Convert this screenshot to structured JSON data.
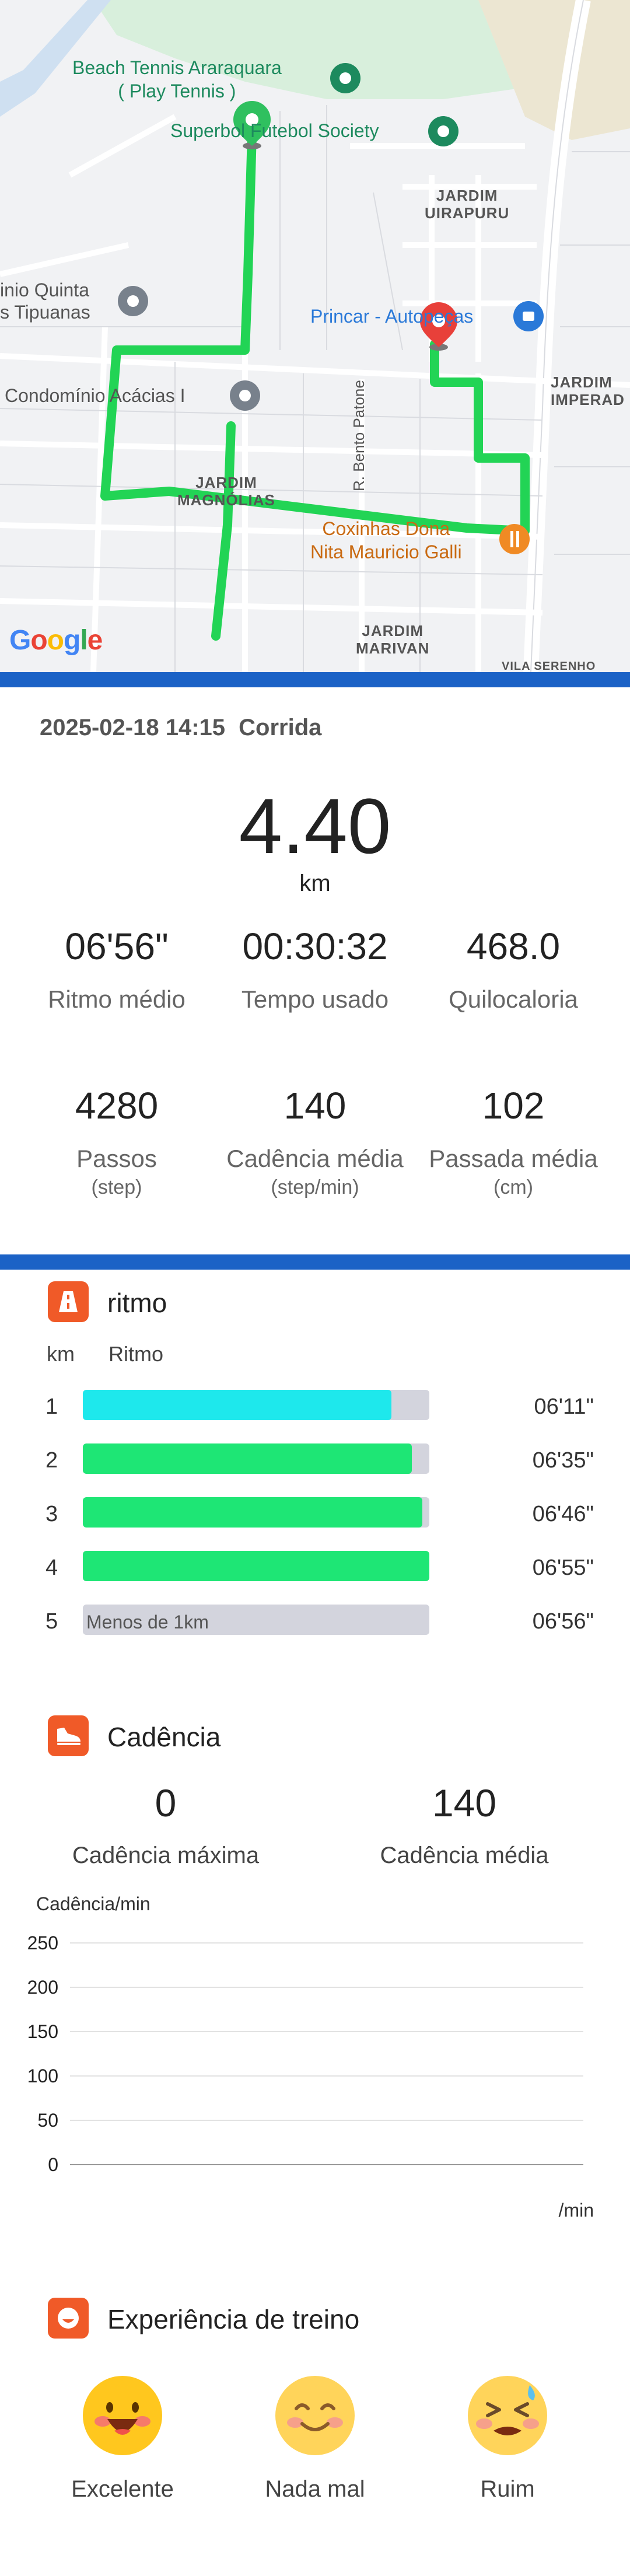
{
  "map": {
    "labels": {
      "beach_tennis": "Beach Tennis Araraquara\n( Play Tennis )",
      "superbol": "Superbol Futebol Society",
      "jardim_uirapuru": "JARDIM\nUIRAPURU",
      "quinta": "inio Quinta\ns Tipuanas",
      "princar": "Princar - Autopeças",
      "condominio": "Condomínio Acácias I",
      "jardim_imperador": "JARDIM\nIMPERAD",
      "jardim_magnolias": "JARDIM\nMAGNÓLIAS",
      "bento_patone": "R. Bento Patone",
      "coxinhas": "Coxinhas Dona\nNita Mauricio Galli",
      "jardim_marivan": "JARDIM\nMARIVAN",
      "vila_serenho": "VILA SERENHO"
    },
    "google": [
      "G",
      "o",
      "o",
      "g",
      "l",
      "e"
    ]
  },
  "summary": {
    "datetime": "2025-02-18 14:15",
    "activity": "Corrida",
    "distance": "4.40",
    "distance_unit": "km",
    "pace": "06'56\"",
    "pace_label": "Ritmo médio",
    "time": "00:30:32",
    "time_label": "Tempo usado",
    "calories": "468.0",
    "calories_label": "Quilocaloria",
    "steps": "4280",
    "steps_label": "Passos",
    "steps_unit": "(step)",
    "cadence": "140",
    "cadence_label": "Cadência média",
    "cadence_unit": "(step/min)",
    "stride": "102",
    "stride_label": "Passada média",
    "stride_unit": "(cm)"
  },
  "pace_section": {
    "title": "ritmo",
    "col_km": "km",
    "col_pace": "Ritmo",
    "rows": [
      {
        "km": "1",
        "time": "06'11\"",
        "fill": 0.89,
        "color": "#1ee8ec",
        "label": ""
      },
      {
        "km": "2",
        "time": "06'35\"",
        "fill": 0.95,
        "color": "#1ee675",
        "label": ""
      },
      {
        "km": "3",
        "time": "06'46\"",
        "fill": 0.98,
        "color": "#1ee675",
        "label": ""
      },
      {
        "km": "4",
        "time": "06'55\"",
        "fill": 1.0,
        "color": "#1ee675",
        "label": ""
      },
      {
        "km": "5",
        "time": "06'56\"",
        "fill": 0.0,
        "color": "#d3d4dd",
        "label": "Menos de 1km"
      }
    ]
  },
  "cadence_section": {
    "title": "Cadência",
    "max_value": "0",
    "max_label": "Cadência máxima",
    "avg_value": "140",
    "avg_label": "Cadência média",
    "y_axis_label": "Cadência/min",
    "x_unit": "/min",
    "y_ticks": [
      "250",
      "200",
      "150",
      "100",
      "50",
      "0"
    ]
  },
  "chart_data": {
    "type": "line",
    "title": "",
    "xlabel": "/min",
    "ylabel": "Cadência/min",
    "ylim": [
      0,
      250
    ],
    "y_ticks": [
      0,
      50,
      100,
      150,
      200,
      250
    ],
    "series": [],
    "grid": true
  },
  "experience_section": {
    "title": "Experiência de treino",
    "options": [
      {
        "label": "Excelente",
        "icon": "excellent-face-icon"
      },
      {
        "label": "Nada mal",
        "icon": "smile-face-icon"
      },
      {
        "label": "Ruim",
        "icon": "tired-face-icon"
      }
    ]
  },
  "colors": {
    "accent_blue": "#1b62c6",
    "section_icon": "#f05a28",
    "route": "#22d455",
    "start_pin": "#2fc05f",
    "end_pin": "#e8403a"
  }
}
